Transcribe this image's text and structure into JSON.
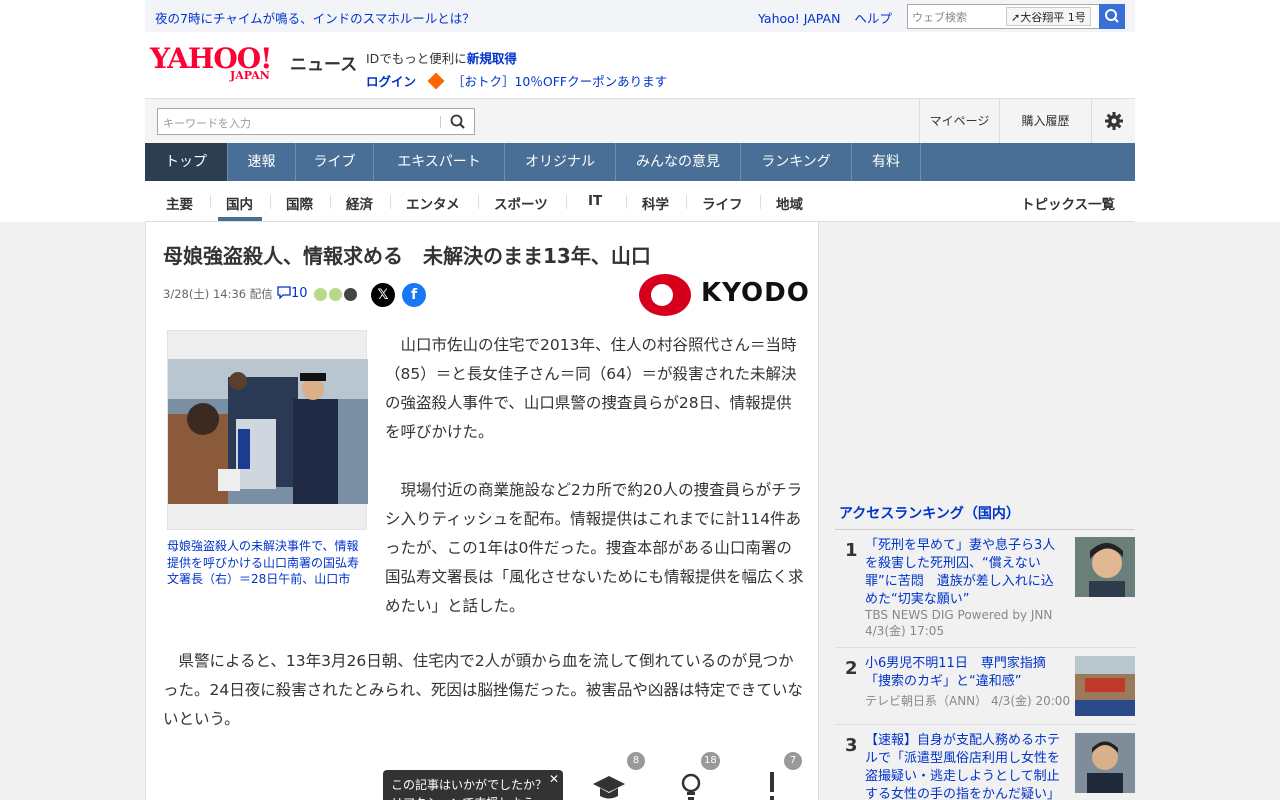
{
  "topbar": {
    "promo": "夜の7時にチャイムが鳴る、インドのスマホルールとは？",
    "links": [
      "Yahoo! JAPAN",
      "ヘルプ"
    ],
    "search_placeholder": "ウェブ検索",
    "trend": "大谷翔平 1号"
  },
  "logo": {
    "brand": "YAHOO!",
    "sub": "JAPAN",
    "service": "ニュース"
  },
  "login": {
    "line1_prefix": "IDでもっと便利に",
    "line1_link": "新規取得",
    "login_label": "ログイン",
    "coupon": "［おトク］10％OFFクーポンあります"
  },
  "searchrow": {
    "keyword_placeholder": "キーワードを入力",
    "mypage": "マイページ",
    "history": "購入履歴"
  },
  "mainnav": [
    "トップ",
    "速報",
    "ライブ",
    "エキスパート",
    "オリジナル",
    "みんなの意見",
    "ランキング",
    "有料"
  ],
  "subnav": [
    "主要",
    "国内",
    "国際",
    "経済",
    "エンタメ",
    "スポーツ",
    "IT",
    "科学",
    "ライフ",
    "地域"
  ],
  "subnav_right": "トピックス一覧",
  "article": {
    "title": "母娘強盗殺人、情報求める　未解決のまま13年、山口",
    "date": "3/28(土) 14:36",
    "delivery": "配信",
    "comment_count": "10",
    "provider": "KYODO",
    "caption": "母娘強盗殺人の未解決事件で、情報提供を呼びかける山口南署の国弘寿文署長（右）＝28日午前、山口市",
    "para1": "山口市佐山の住宅で2013年、住人の村谷照代さん＝当時（85）＝と長女佳子さん＝同（64）＝が殺害された未解決の強盗殺人事件で、山口県警の捜査員らが28日、情報提供を呼びかけた。",
    "para2": "現場付近の商業施設など2カ所で約20人の捜査員らがチラシ入りティッシュを配布。情報提供はこれまでに計114件あったが、この1年は0件だった。捜査本部がある山口南署の国弘寿文署長は「風化させないためにも情報提供を幅広く求めたい」と話した。",
    "para3": "県警によると、13年3月26日朝、住宅内で2人が頭から血を流して倒れているのが見つかった。24日夜に殺害されたとみられ、死因は脳挫傷だった。被害品や凶器は特定できていないという。",
    "tooltip": "この記事はいかがでしたか？\nリアクションで支援しよう",
    "reactions": [
      {
        "icon": "graduation-cap-icon",
        "count": "8"
      },
      {
        "icon": "lightbulb-icon",
        "count": "18"
      },
      {
        "icon": "exclamation-icon",
        "count": "7"
      }
    ]
  },
  "ranking": {
    "header": "アクセスランキング（国内）",
    "items": [
      {
        "rank": "1",
        "title": "「死刑を早めて」妻や息子ら3人を殺害した死刑囚、“償えない罪”に苦悶　遺族が差し入れに込めた“切実な願い”",
        "source": "TBS NEWS DIG Powered by JNN",
        "date": "4/3(金) 17:05"
      },
      {
        "rank": "2",
        "title": "小6男児不明11日　専門家指摘「捜索のカギ」と“違和感”",
        "source": "テレビ朝日系（ANN）",
        "date": "4/3(金) 20:00"
      },
      {
        "rank": "3",
        "title": "【速報】自身が支配人務めるホテルで「派遣型風俗店利用し女性を盗撮疑い・逃走しようとして制止する女性の手の指をかんだ疑い」",
        "source": "",
        "date": ""
      }
    ]
  },
  "colors": {
    "accent": "#0033cc",
    "nav": "#4a6f96",
    "nav_active": "#2c3e50",
    "brand": "#ff0033"
  }
}
